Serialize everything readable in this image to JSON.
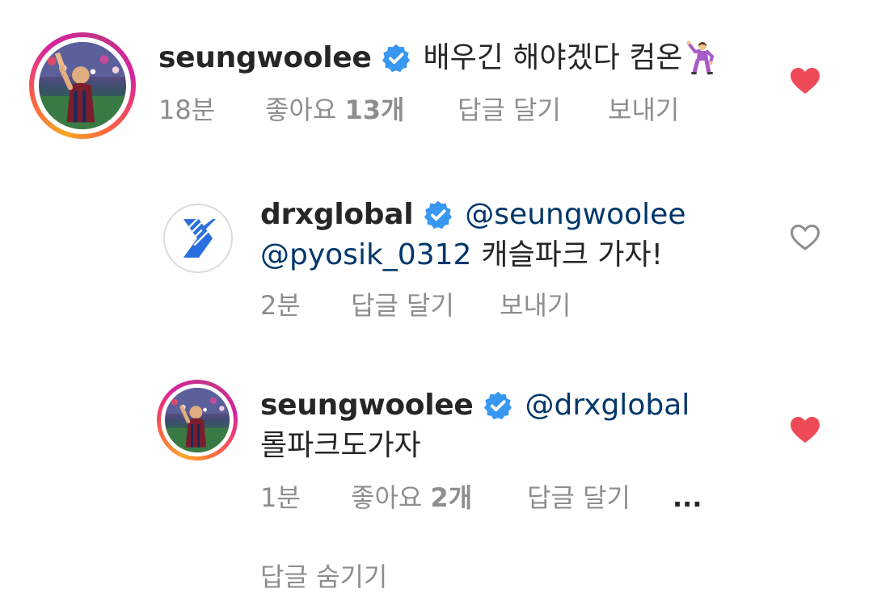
{
  "colors": {
    "text": "#262626",
    "meta": "#8e8e8e",
    "mention": "#00376b",
    "verified": "#3897f0",
    "heart_liked": "#ed4956",
    "heart_outline": "#8e8e8e"
  },
  "comments": [
    {
      "username": "seungwoolee",
      "verified": true,
      "text": "배우긴 해야겠다 컴온",
      "emoji": "dancing-man-emoji",
      "time": "18분",
      "likes_label": "좋아요",
      "likes_count": "13개",
      "reply_label": "답글 달기",
      "send_label": "보내기",
      "liked": true,
      "avatar_icon": "player-photo-avatar"
    },
    {
      "username": "drxglobal",
      "verified": true,
      "mention_1": "@seungwoolee",
      "mention_2": "@pyosik_0312",
      "text": "캐슬파크 가자!",
      "time": "2분",
      "reply_label": "답글 달기",
      "send_label": "보내기",
      "liked": false,
      "avatar_icon": "drx-logo-avatar"
    },
    {
      "username": "seungwoolee",
      "verified": true,
      "mention_1": "@drxglobal",
      "text": "롤파크도가자",
      "time": "1분",
      "likes_label": "좋아요",
      "likes_count": "2개",
      "reply_label": "답글 달기",
      "more_label": "...",
      "liked": true,
      "avatar_icon": "player-photo-avatar"
    }
  ],
  "footer": {
    "partial_text": "답글 숨기기"
  }
}
